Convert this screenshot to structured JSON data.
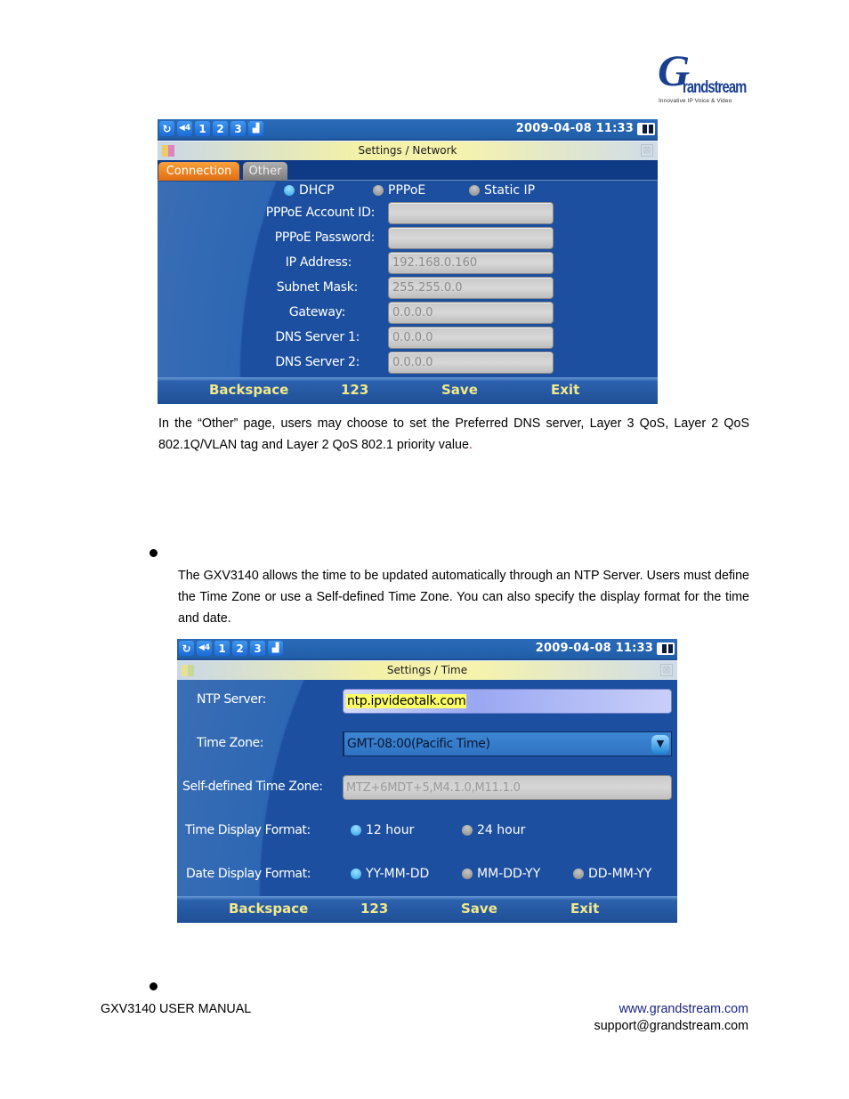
{
  "logo": {
    "glyph": "G",
    "word": "randstream",
    "tagline": "Innovative IP Voice & Video"
  },
  "statusbar": {
    "icons": [
      {
        "name": "refresh-icon",
        "glyph": "↻"
      },
      {
        "name": "speaker-volume-icon",
        "glyph": "◀4"
      },
      {
        "name": "line-1-icon",
        "glyph": "1"
      },
      {
        "name": "line-2-icon",
        "glyph": "2"
      },
      {
        "name": "line-3-icon",
        "glyph": "3"
      },
      {
        "name": "handset-icon",
        "glyph": "▟"
      }
    ],
    "datetime": "2009-04-08 11:33"
  },
  "network_screen": {
    "title": "Settings / Network",
    "close_glyph": "⊠",
    "tabs": [
      {
        "label": "Connection",
        "active": true
      },
      {
        "label": "Other",
        "active": false
      }
    ],
    "connection_type": {
      "options": [
        "DHCP",
        "PPPoE",
        "Static IP"
      ],
      "selected": "DHCP"
    },
    "fields": [
      {
        "label": "PPPoE Account ID:",
        "value": ""
      },
      {
        "label": "PPPoE Password:",
        "value": ""
      },
      {
        "label": "IP Address:",
        "value": "192.168.0.160"
      },
      {
        "label": "Subnet Mask:",
        "value": "255.255.0.0"
      },
      {
        "label": "Gateway:",
        "value": "0.0.0.0"
      },
      {
        "label": "DNS Server 1:",
        "value": "0.0.0.0"
      },
      {
        "label": "DNS Server 2:",
        "value": "0.0.0.0"
      }
    ],
    "softkeys": [
      "Backspace",
      "123",
      "Save",
      "Exit"
    ]
  },
  "paragraph_other": {
    "text": "In the “Other” page, users may choose to set the Preferred DNS server, Layer 3 QoS, Layer 2 QoS 802.1Q/VLAN tag and Layer 2 QoS 802.1 priority value",
    "trailing": "."
  },
  "paragraph_time": "The GXV3140 allows the time to be updated automatically through an NTP Server. Users must define the Time Zone or use a Self-defined Time Zone. You can also specify the display format for the time and date.",
  "time_screen": {
    "title": "Settings / Time",
    "close_glyph": "⊠",
    "ntp_server": {
      "label": "NTP Server:",
      "value": "ntp.ipvideotalk.com"
    },
    "time_zone": {
      "label": "Time Zone:",
      "value": "GMT-08:00(Pacific Time)",
      "arrow": "▼"
    },
    "self_defined_tz": {
      "label": "Self-defined Time Zone:",
      "value": "MTZ+6MDT+5,M4.1.0,M11.1.0"
    },
    "time_display_format": {
      "label": "Time Display Format:",
      "options": [
        "12 hour",
        "24 hour"
      ],
      "selected": "12 hour"
    },
    "date_display_format": {
      "label": "Date Display Format:",
      "options": [
        "YY-MM-DD",
        "MM-DD-YY",
        "DD-MM-YY"
      ],
      "selected": "YY-MM-DD"
    },
    "softkeys": [
      "Backspace",
      "123",
      "Save",
      "Exit"
    ]
  },
  "footer": {
    "manual_title": "GXV3140 USER MANUAL",
    "website": "www.grandstream.com",
    "email": "support@grandstream.com"
  }
}
